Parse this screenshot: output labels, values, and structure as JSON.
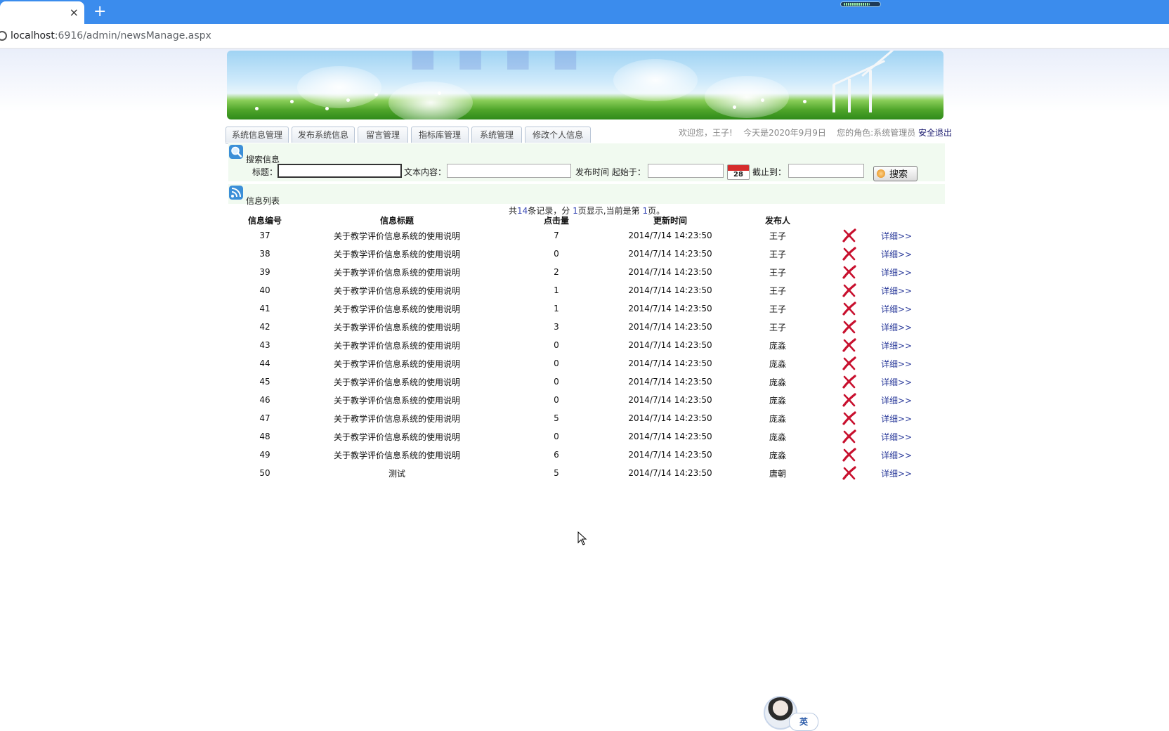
{
  "browser": {
    "tab_close": "×",
    "new_tab": "+",
    "progress_fraction": 0.78,
    "url_host": "localhost",
    "url_path": ":6916/admin/newsManage.aspx"
  },
  "nav": {
    "tabs": [
      "系统信息管理",
      "发布系统信息",
      "留言管理",
      "指标库管理",
      "系统管理",
      "修改个人信息"
    ]
  },
  "welcome": {
    "greeting": "欢迎您，王子!",
    "date": "今天是2020年9月9日",
    "role": "您的角色:系统管理员",
    "logout": "安全退出"
  },
  "search": {
    "section_label": "搜索信息",
    "title_label": "标题：",
    "title_value": "",
    "content_label": "文本内容：",
    "content_value": "",
    "start_label": "发布时间 起始于：",
    "start_value": "",
    "calendar_text": "28",
    "end_label": "截止到：",
    "end_value": "",
    "button_label": "搜索"
  },
  "list": {
    "section_label": "信息列表",
    "summary": {
      "prefix": "共",
      "total": "14",
      "mid1": "条记录，分",
      "pages": "1",
      "mid2": "页显示,当前是第",
      "current": "1",
      "suffix": "页。"
    },
    "columns": [
      "信息编号",
      "信息标题",
      "点击量",
      "更新时间",
      "发布人",
      "",
      ""
    ],
    "detail_label": "详细>>",
    "rows": [
      {
        "id": "37",
        "title": "关于教学评价信息系统的使用说明",
        "clicks": "7",
        "time": "2014/7/14 14:23:50",
        "author": "王子"
      },
      {
        "id": "38",
        "title": "关于教学评价信息系统的使用说明",
        "clicks": "0",
        "time": "2014/7/14 14:23:50",
        "author": "王子"
      },
      {
        "id": "39",
        "title": "关于教学评价信息系统的使用说明",
        "clicks": "2",
        "time": "2014/7/14 14:23:50",
        "author": "王子"
      },
      {
        "id": "40",
        "title": "关于教学评价信息系统的使用说明",
        "clicks": "1",
        "time": "2014/7/14 14:23:50",
        "author": "王子"
      },
      {
        "id": "41",
        "title": "关于教学评价信息系统的使用说明",
        "clicks": "1",
        "time": "2014/7/14 14:23:50",
        "author": "王子"
      },
      {
        "id": "42",
        "title": "关于教学评价信息系统的使用说明",
        "clicks": "3",
        "time": "2014/7/14 14:23:50",
        "author": "王子"
      },
      {
        "id": "43",
        "title": "关于教学评价信息系统的使用说明",
        "clicks": "0",
        "time": "2014/7/14 14:23:50",
        "author": "庞淼"
      },
      {
        "id": "44",
        "title": "关于教学评价信息系统的使用说明",
        "clicks": "0",
        "time": "2014/7/14 14:23:50",
        "author": "庞淼"
      },
      {
        "id": "45",
        "title": "关于教学评价信息系统的使用说明",
        "clicks": "0",
        "time": "2014/7/14 14:23:50",
        "author": "庞淼"
      },
      {
        "id": "46",
        "title": "关于教学评价信息系统的使用说明",
        "clicks": "0",
        "time": "2014/7/14 14:23:50",
        "author": "庞淼"
      },
      {
        "id": "47",
        "title": "关于教学评价信息系统的使用说明",
        "clicks": "5",
        "time": "2014/7/14 14:23:50",
        "author": "庞淼"
      },
      {
        "id": "48",
        "title": "关于教学评价信息系统的使用说明",
        "clicks": "0",
        "time": "2014/7/14 14:23:50",
        "author": "庞淼"
      },
      {
        "id": "49",
        "title": "关于教学评价信息系统的使用说明",
        "clicks": "6",
        "time": "2014/7/14 14:23:50",
        "author": "庞淼"
      },
      {
        "id": "50",
        "title": "测试",
        "clicks": "5",
        "time": "2014/7/14 14:23:50",
        "author": "唐朝"
      }
    ]
  },
  "ime": {
    "label": "英"
  },
  "colors": {
    "tabbar": "#3b8ced",
    "panel": "#f1faf0",
    "delete": "#c8102e",
    "detail_link": "#2a3a9a"
  },
  "icons": {
    "search_section": "magnifier-icon",
    "list_section": "rss-icon",
    "row_delete": "delete-x-icon",
    "calendar": "calendar-icon"
  }
}
